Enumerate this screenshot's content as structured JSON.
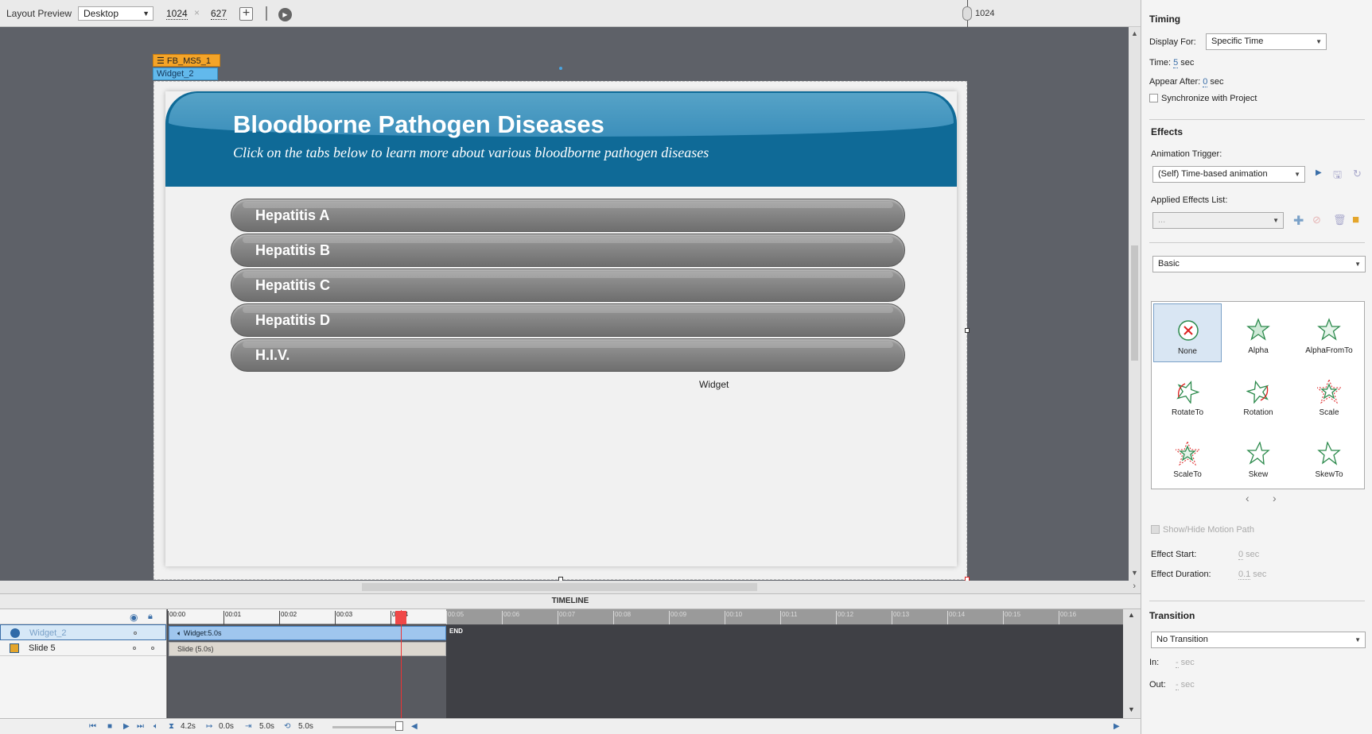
{
  "toolbar": {
    "layout_preview_label": "Layout Preview",
    "device_select": "Desktop",
    "width": "1024",
    "times": "×",
    "height": "627",
    "add_icon": "plus-icon",
    "play_icon": "play-icon",
    "ruler_value": "1024"
  },
  "stage": {
    "tag_fb": "FB_MS5_1",
    "tag_widget": "Widget_2",
    "widget_label": "Widget",
    "slide": {
      "title": "Bloodborne Pathogen Diseases",
      "subtitle": "Click on the tabs below to learn more about various bloodborne pathogen diseases",
      "tabs": [
        "Hepatitis A",
        "Hepatitis B",
        "Hepatitis C",
        "Hepatitis D",
        "H.I.V."
      ]
    }
  },
  "timeline": {
    "title": "TIMELINE",
    "ticks": [
      "00:00",
      "00:01",
      "00:02",
      "00:03",
      "00:04",
      "00:05",
      "00:06",
      "00:07",
      "00:08",
      "00:09",
      "00:10",
      "00:11",
      "00:12",
      "00:13",
      "00:14",
      "00:15",
      "00:16"
    ],
    "layers": [
      {
        "name": "Widget_2",
        "bar": "Widget:5.0s"
      },
      {
        "name": "Slide 5",
        "bar": "Slide (5.0s)"
      }
    ],
    "end_label": "END",
    "bottom": {
      "current": "4.2s",
      "start": "0.0s",
      "end": "5.0s",
      "duration": "5.0s"
    }
  },
  "properties": {
    "timing": {
      "title": "Timing",
      "display_for_label": "Display For:",
      "display_for_value": "Specific Time",
      "time_label": "Time:",
      "time_value": "5",
      "time_unit": "sec",
      "appear_after_label": "Appear After:",
      "appear_after_value": "0",
      "appear_after_unit": "sec",
      "sync_label": "Synchronize with Project"
    },
    "effects": {
      "title": "Effects",
      "trigger_label": "Animation Trigger:",
      "trigger_value": "(Self) Time-based animation",
      "applied_label": "Applied Effects List:",
      "applied_value": "...",
      "category_value": "Basic",
      "items": [
        "None",
        "Alpha",
        "AlphaFromTo",
        "RotateTo",
        "Rotation",
        "Scale",
        "ScaleTo",
        "Skew",
        "SkewTo"
      ],
      "show_hide_label": "Show/Hide Motion Path",
      "effect_start_label": "Effect Start:",
      "effect_start_value": "0",
      "effect_start_unit": "sec",
      "effect_duration_label": "Effect Duration:",
      "effect_duration_value": "0.1",
      "effect_duration_unit": "sec"
    },
    "transition": {
      "title": "Transition",
      "value": "No Transition",
      "in_label": "In:",
      "in_value": "-",
      "in_unit": "sec",
      "out_label": "Out:",
      "out_value": "-",
      "out_unit": "sec"
    }
  }
}
